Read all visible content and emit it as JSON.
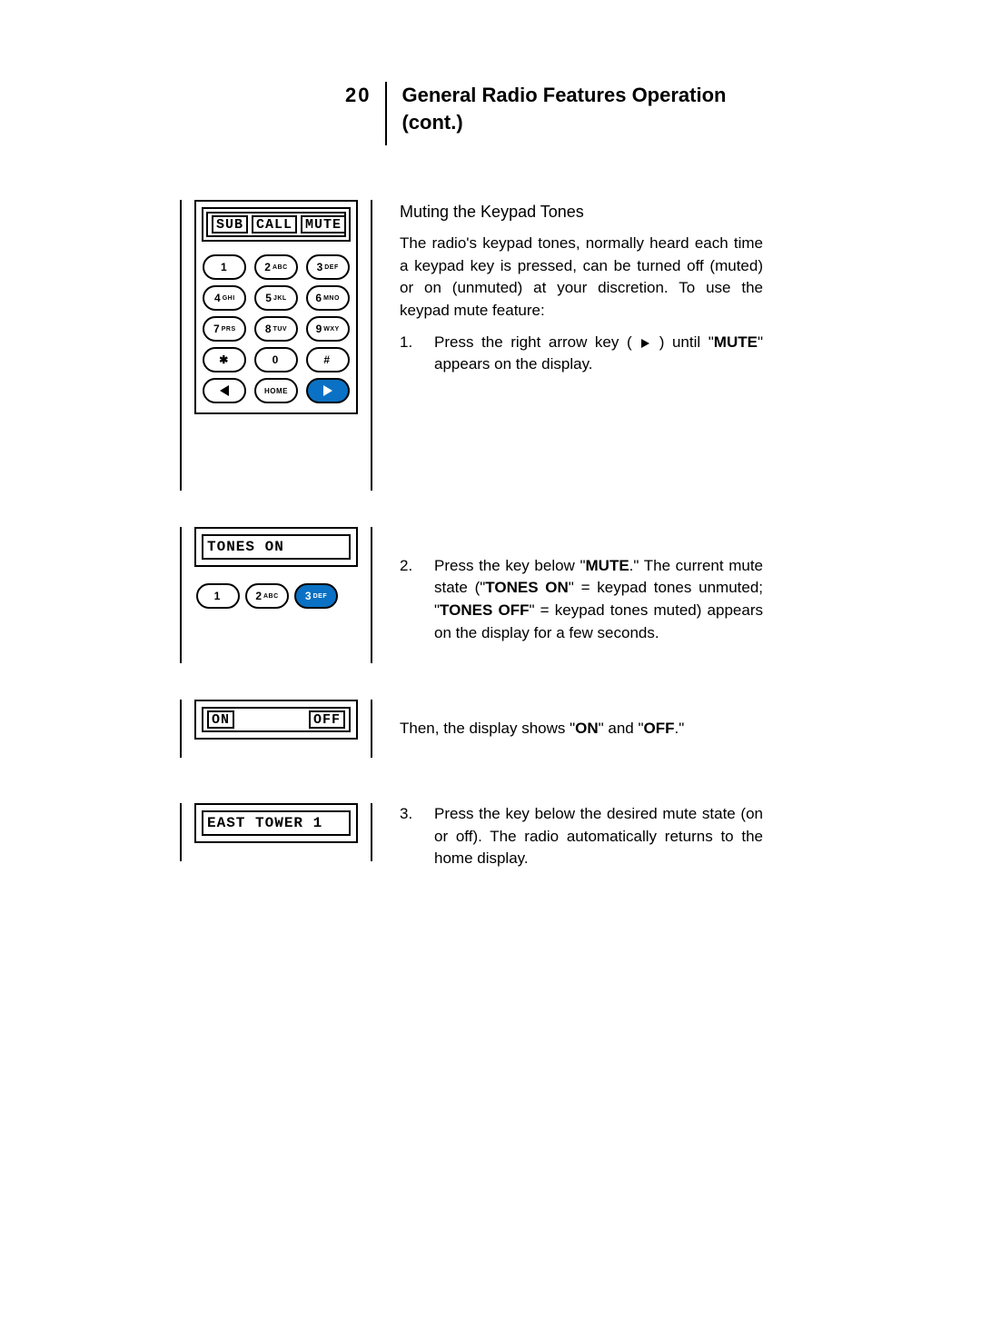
{
  "header": {
    "page_number": "20",
    "title_line1": "General Radio Features Operation",
    "title_line2": "(cont.)"
  },
  "subsection": {
    "title": "Muting the Keypad Tones",
    "intro": "The radio's keypad tones, normally heard each time a keypad key is pressed, can be turned off (muted) or on (unmuted) at your discretion. To use the keypad mute feature:"
  },
  "steps": {
    "s1": {
      "num": "1.",
      "pre": "Press the right arrow key ( ",
      "post": " ) until \"",
      "bold1": "MUTE",
      "tail": "\" appears on the display."
    },
    "s2": {
      "num": "2.",
      "a": "Press the key below \"",
      "b1": "MUTE",
      "b": ".\" The current mute state (\"",
      "b2": "TONES ON",
      "c": "\" = keypad tones unmuted; \"",
      "b3": "TONES OFF",
      "d": "\" = keypad tones muted) appears on the display for a few seconds."
    },
    "then": {
      "a": "Then, the display shows \"",
      "b1": "ON",
      "b": "\" and \"",
      "b2": "OFF",
      "c": ".\""
    },
    "s3": {
      "num": "3.",
      "text": "Press the key below the desired mute state (on or off). The radio automatically returns to the home display."
    }
  },
  "display": {
    "panel1": {
      "seg1": "SUB",
      "seg2": "CALL",
      "seg3": "MUTE"
    },
    "panel2": {
      "line": "TONES ON"
    },
    "panel3": {
      "seg1": "ON",
      "seg2": "OFF"
    },
    "panel4": {
      "line": "EAST TOWER 1"
    }
  },
  "keys": {
    "k1": {
      "big": "1",
      "sub": ""
    },
    "k2": {
      "big": "2",
      "sub": "ABC"
    },
    "k3": {
      "big": "3",
      "sub": "DEF"
    },
    "k4": {
      "big": "4",
      "sub": "GHI"
    },
    "k5": {
      "big": "5",
      "sub": "JKL"
    },
    "k6": {
      "big": "6",
      "sub": "MNO"
    },
    "k7": {
      "big": "7",
      "sub": "PRS"
    },
    "k8": {
      "big": "8",
      "sub": "TUV"
    },
    "k9": {
      "big": "9",
      "sub": "WXY"
    },
    "kstar": "✱",
    "k0": "0",
    "khash": "#",
    "khome": "HOME"
  }
}
